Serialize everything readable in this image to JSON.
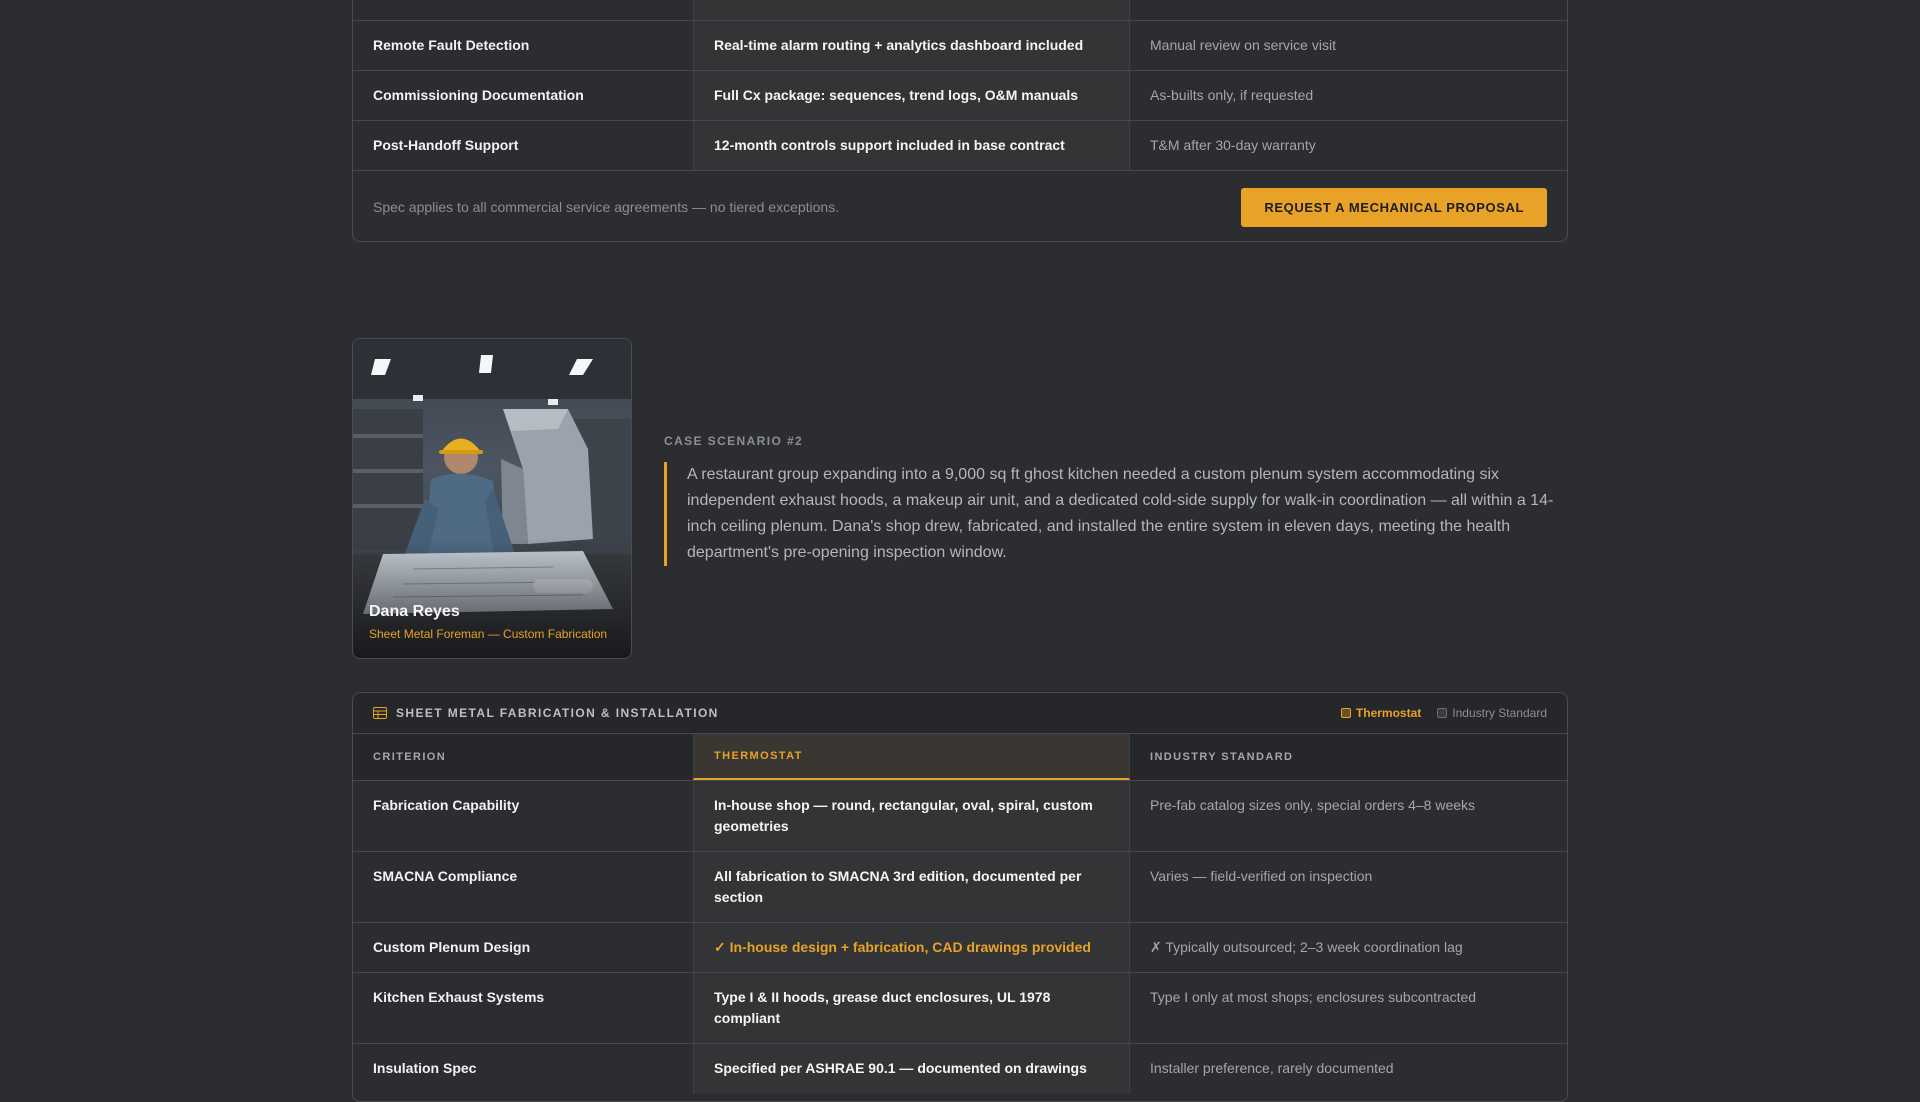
{
  "spec_table": {
    "rows": [
      {
        "criterion": "",
        "thermostat": "",
        "standard": ""
      },
      {
        "criterion": "Remote Fault Detection",
        "thermostat": "Real-time alarm routing + analytics dashboard included",
        "standard": "Manual review on service visit"
      },
      {
        "criterion": "Commissioning Documentation",
        "thermostat": "Full Cx package: sequences, trend logs, O&M manuals",
        "standard": "As-builts only, if requested"
      },
      {
        "criterion": "Post-Handoff Support",
        "thermostat": "12-month controls support included in base contract",
        "standard": "T&M after 30-day warranty"
      }
    ],
    "footer_note": "Spec applies to all commercial service agreements — no tiered exceptions.",
    "cta_label": "REQUEST A MECHANICAL PROPOSAL"
  },
  "case": {
    "person_name": "Dana Reyes",
    "person_role": "Sheet Metal Foreman — Custom Fabrication",
    "eyebrow": "CASE SCENARIO #2",
    "body": "A restaurant group expanding into a 9,000 sq ft ghost kitchen needed a custom plenum system accommodating six independent exhaust hoods, a makeup air unit, and a dedicated cold-side supply for walk-in coordination — all within a 14-inch ceiling plenum. Dana's shop drew, fabricated, and installed the entire system in eleven days, meeting the health department's pre-opening inspection window."
  },
  "fab_table": {
    "title": "SHEET METAL FABRICATION & INSTALLATION",
    "legend": {
      "thermostat": "Thermostat",
      "standard": "Industry Standard"
    },
    "columns": {
      "criterion": "CRITERION",
      "thermostat": "THERMOSTAT",
      "standard": "INDUSTRY STANDARD"
    },
    "rows": [
      {
        "criterion": "Fabrication Capability",
        "thermostat": "In-house shop — round, rectangular, oval, spiral, custom geometries",
        "standard": "Pre-fab catalog sizes only, special orders 4–8 weeks"
      },
      {
        "criterion": "SMACNA Compliance",
        "thermostat": "All fabrication to SMACNA 3rd edition, documented per section",
        "standard": "Varies — field-verified on inspection"
      },
      {
        "criterion": "Custom Plenum Design",
        "thermostat": "✓ In-house design + fabrication, CAD drawings provided",
        "standard": "✗ Typically outsourced; 2–3 week coordination lag"
      },
      {
        "criterion": "Kitchen Exhaust Systems",
        "thermostat": "Type I & II hoods, grease duct enclosures, UL 1978 compliant",
        "standard": "Type I only at most shops; enclosures subcontracted"
      },
      {
        "criterion": "Insulation Spec",
        "thermostat": "Specified per ASHRAE 90.1 — documented on drawings",
        "standard": "Installer preference, rarely documented"
      }
    ]
  },
  "colors": {
    "accent": "#e8a228",
    "background": "#2b2d31"
  }
}
